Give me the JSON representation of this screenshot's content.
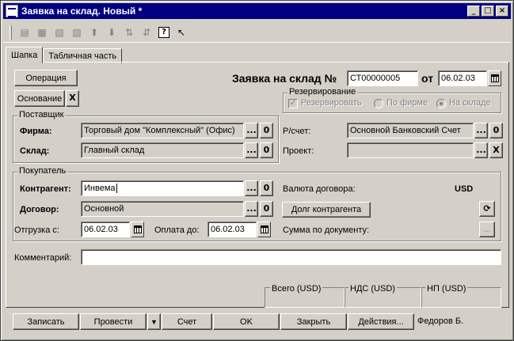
{
  "window": {
    "title": "Заявка на склад. Новый *",
    "controls": {
      "minimize": "_",
      "maximize": "□",
      "close": "×"
    }
  },
  "toolbar": {
    "icons": [
      "new-row-icon",
      "add-row-icon",
      "delete-row-icon",
      "edit-row-icon",
      "move-up-icon",
      "move-down-icon",
      "sort-asc-icon",
      "sort-desc-icon",
      "help-icon",
      "context-help-icon"
    ],
    "help_glyph": "?"
  },
  "tabs": [
    {
      "label": "Шапка",
      "active": true
    },
    {
      "label": "Табличная часть",
      "active": false
    }
  ],
  "header": {
    "operation_button": "Операция",
    "basis_button": "Основание",
    "basis_clear": "X",
    "doc_title": "Заявка на склад №",
    "doc_number": "СТ00000005",
    "date_label": "от",
    "doc_date": "06.02.03"
  },
  "reservation": {
    "title": "Резервирование",
    "reserve_label": "Резервировать",
    "by_company_label": "По фирме",
    "by_warehouse_label": "На складе"
  },
  "supplier": {
    "title": "Поставщик",
    "firm_label": "Фирма:",
    "firm_value": "Торговый дом \"Комплексный\" (Офис)",
    "warehouse_label": "Склад:",
    "warehouse_value": "Главный склад",
    "select_glyph": "...",
    "open_glyph": "0"
  },
  "bank": {
    "account_label": "Р/счет:",
    "account_value": "Основной Банковский Счет",
    "project_label": "Проект:",
    "project_value": "",
    "clear_glyph": "X"
  },
  "buyer": {
    "title": "Покупатель",
    "counterparty_label": "Контрагент:",
    "counterparty_value": "Инвема",
    "contract_label": "Договор:",
    "contract_value": "Основной",
    "contract_currency_label": "Валюта договора:",
    "contract_currency_value": "USD",
    "debt_button": "Долг контрагента",
    "shipment_label": "Отгрузка с:",
    "shipment_date": "06.02.03",
    "payment_label": "Оплата до:",
    "payment_date": "06.02.03",
    "doc_sum_label": "Сумма по документу:",
    "doc_sum_button": "..."
  },
  "comment": {
    "label": "Комментарий:",
    "value": ""
  },
  "totals": {
    "total_label": "Всего (USD)",
    "vat_label": "НДС (USD)",
    "sales_tax_label": "НП (USD)"
  },
  "footer": {
    "save": "Записать",
    "post": "Провести",
    "post_menu": "▼",
    "invoice": "Счет",
    "ok": "OK",
    "close": "Закрыть",
    "actions": "Действия...",
    "author": "Федоров Б."
  }
}
